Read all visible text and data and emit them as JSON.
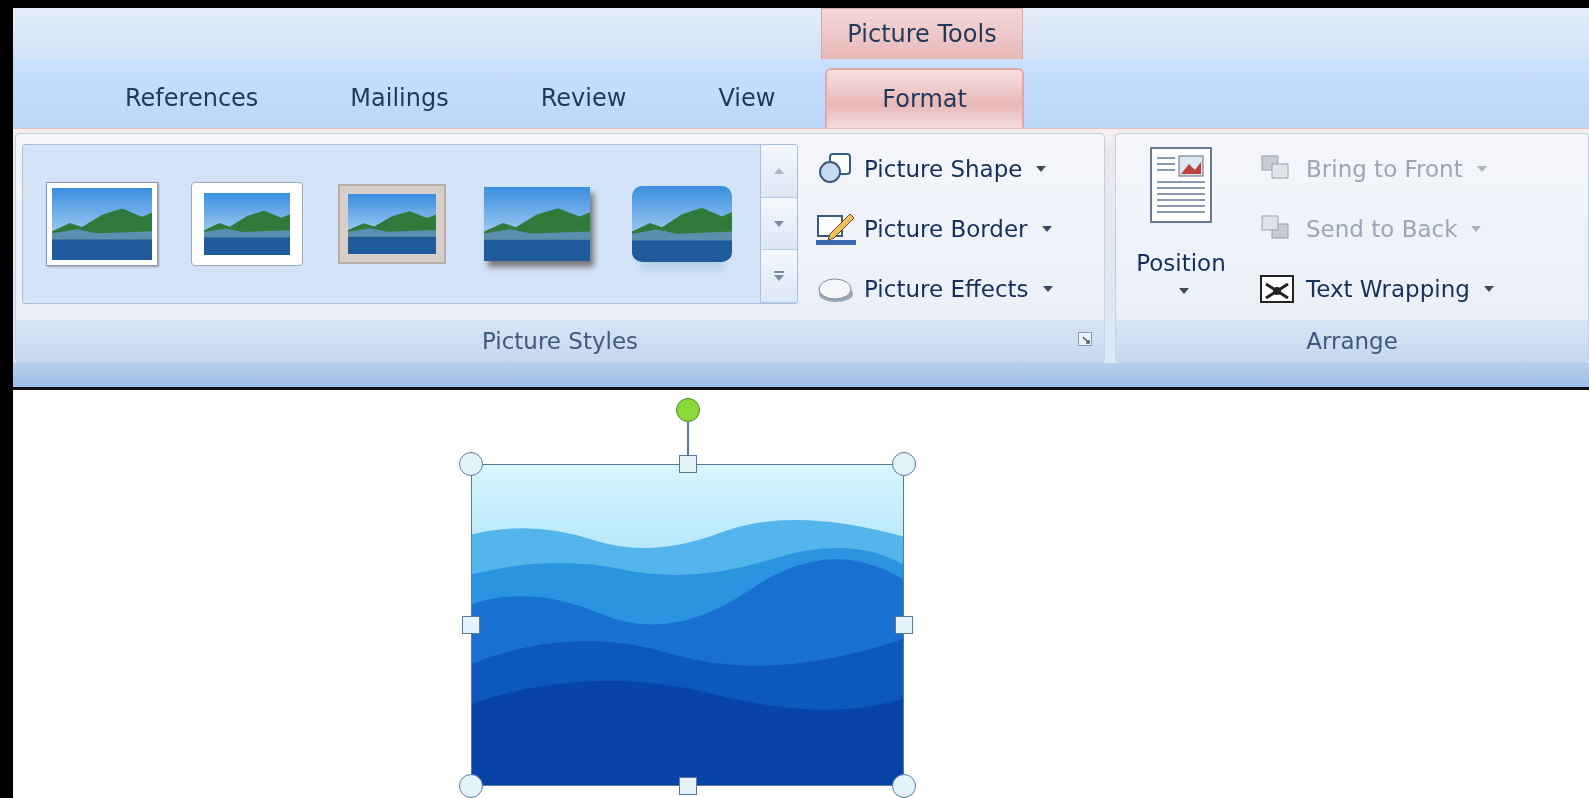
{
  "contextual_tab": {
    "label": "Picture Tools"
  },
  "tabs": [
    {
      "label": "References",
      "selected": false
    },
    {
      "label": "Mailings",
      "selected": false
    },
    {
      "label": "Review",
      "selected": false
    },
    {
      "label": "View",
      "selected": false
    },
    {
      "label": "Format",
      "selected": true
    }
  ],
  "picture_styles": {
    "label": "Picture Styles",
    "gallery": [
      {
        "kind": "white-frame"
      },
      {
        "kind": "thick-frame"
      },
      {
        "kind": "matte"
      },
      {
        "kind": "shadow"
      },
      {
        "kind": "reflection"
      }
    ],
    "commands": [
      {
        "kind": "shape",
        "label": "Picture Shape",
        "disabled": false
      },
      {
        "kind": "border",
        "label": "Picture Border",
        "disabled": false
      },
      {
        "kind": "effects",
        "label": "Picture Effects",
        "disabled": false
      }
    ]
  },
  "arrange": {
    "label": "Arrange",
    "position": {
      "label": "Position"
    },
    "commands": [
      {
        "kind": "bring-front",
        "label": "Bring to Front",
        "disabled": true
      },
      {
        "kind": "send-back",
        "label": "Send to Back",
        "disabled": true
      },
      {
        "kind": "wrap",
        "label": "Text Wrapping",
        "disabled": false
      }
    ]
  },
  "document": {
    "picture": {
      "selected": true
    }
  }
}
